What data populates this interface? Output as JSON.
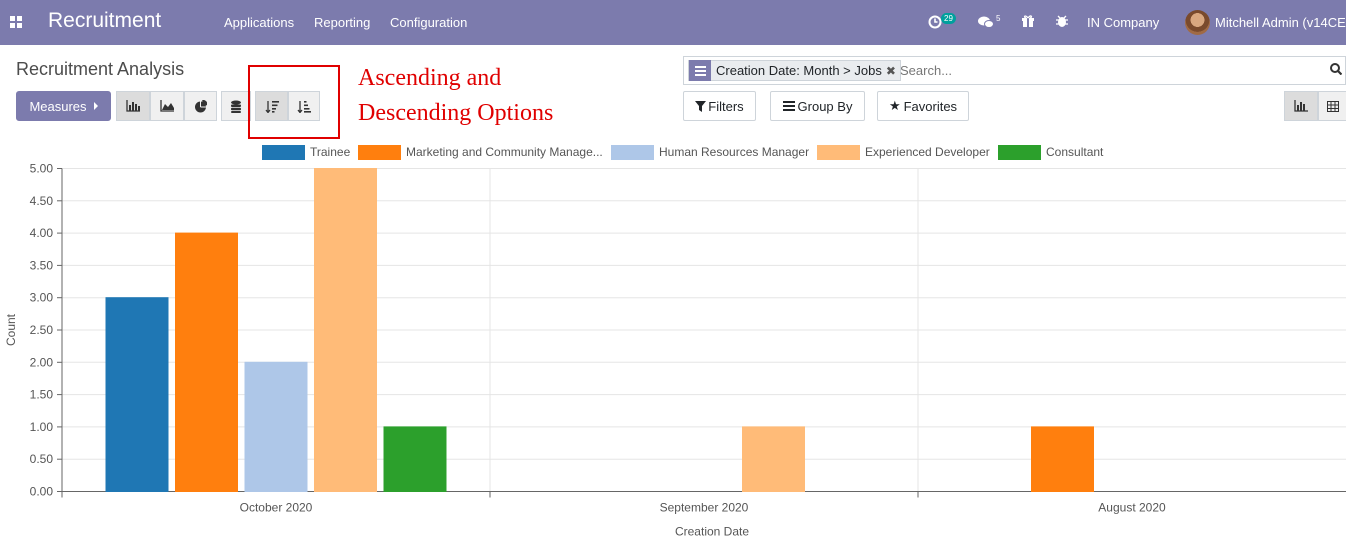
{
  "navbar": {
    "app_title": "Recruitment",
    "menus": [
      "Applications",
      "Reporting",
      "Configuration"
    ],
    "activity_count": "29",
    "message_count": "5",
    "company": "IN Company",
    "user": "Mitchell Admin (v14CE"
  },
  "control_panel": {
    "breadcrumb": "Recruitment Analysis",
    "measures_label": "Measures",
    "search": {
      "facet": "Creation Date: Month > Jobs",
      "placeholder": "Search..."
    },
    "filters_label": "Filters",
    "group_by_label": "Group By",
    "favorites_label": "Favorites"
  },
  "annotation": {
    "line1": "Ascending and",
    "line2": "Descending Options"
  },
  "chart_data": {
    "type": "bar",
    "categories": [
      "October 2020",
      "September 2020",
      "August 2020"
    ],
    "series": [
      {
        "name": "Trainee",
        "color": "#1f77b4",
        "values": [
          3,
          0,
          0
        ]
      },
      {
        "name": "Marketing and Community Manage...",
        "color": "#ff7f0e",
        "values": [
          4,
          0,
          1
        ]
      },
      {
        "name": "Human Resources Manager",
        "color": "#aec7e8",
        "values": [
          2,
          0,
          0
        ]
      },
      {
        "name": "Experienced Developer",
        "color": "#ffbb78",
        "values": [
          5,
          1,
          0
        ]
      },
      {
        "name": "Consultant",
        "color": "#2ca02c",
        "values": [
          1,
          0,
          0
        ]
      }
    ],
    "xlabel": "Creation Date",
    "ylabel": "Count",
    "ylim": [
      0,
      5
    ],
    "yticks": [
      "0.00",
      "0.50",
      "1.00",
      "1.50",
      "2.00",
      "2.50",
      "3.00",
      "3.50",
      "4.00",
      "4.50",
      "5.00"
    ],
    "grid": true,
    "legend": "top"
  }
}
